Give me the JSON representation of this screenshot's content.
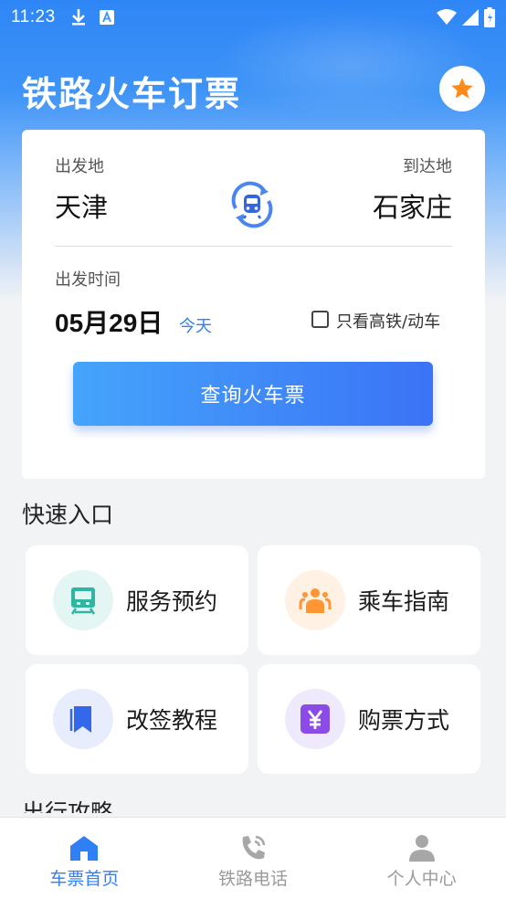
{
  "status_bar": {
    "time": "11:23"
  },
  "header": {
    "title": "铁路火车订票"
  },
  "search_card": {
    "from_label": "出发地",
    "from_city": "天津",
    "to_label": "到达地",
    "to_city": "石家庄",
    "date_label": "出发时间",
    "date_num": "05月29日",
    "today_label": "今天",
    "high_speed_label": "只看高铁/动车",
    "high_speed_checked": false,
    "search_button": "查询火车票"
  },
  "quick_entry": {
    "title": "快速入口",
    "items": [
      {
        "label": "服务预约",
        "icon": "train-icon",
        "bg": "#e3f6f3",
        "color": "#2fb5a0"
      },
      {
        "label": "乘车指南",
        "icon": "people-icon",
        "bg": "#fff1e3",
        "color": "#ff9533"
      },
      {
        "label": "改签教程",
        "icon": "book-icon",
        "bg": "#e8edfd",
        "color": "#3468ea"
      },
      {
        "label": "购票方式",
        "icon": "yen-icon",
        "bg": "#efe9fc",
        "color": "#8a4be9"
      }
    ]
  },
  "next_section": {
    "title": "出行攻略"
  },
  "tabbar": {
    "tabs": [
      {
        "label": "车票首页",
        "active": true
      },
      {
        "label": "铁路电话",
        "active": false
      },
      {
        "label": "个人中心",
        "active": false
      }
    ]
  },
  "colors": {
    "primary": "#2f7ff5",
    "accent_star": "#ff8c1a"
  }
}
